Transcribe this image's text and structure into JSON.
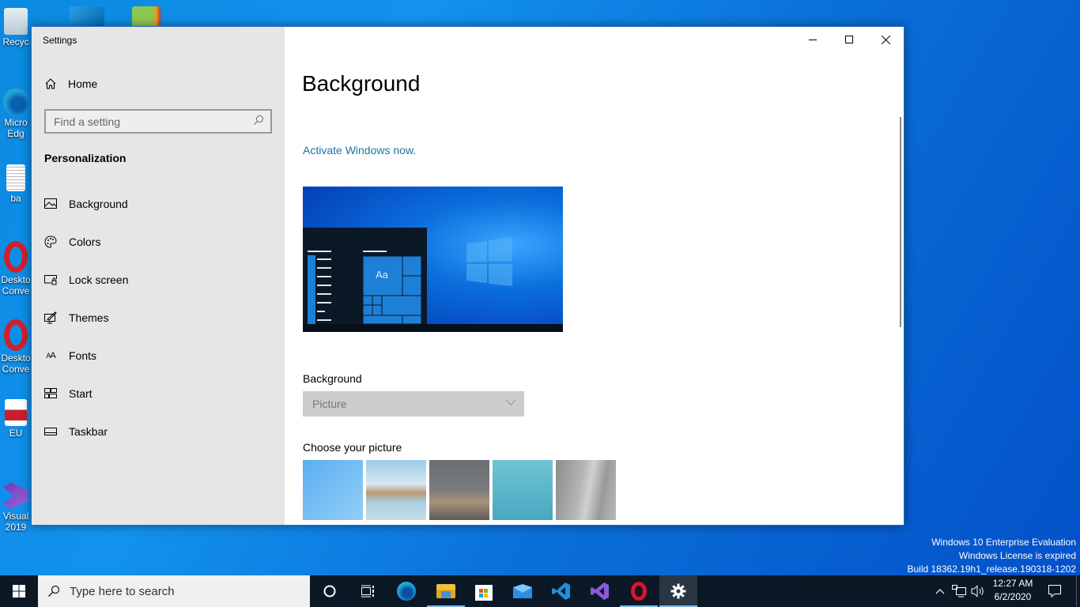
{
  "desktop": {
    "icons": [
      {
        "label": "Recyc",
        "name": "recycle-bin"
      },
      {
        "label": "Micro Edg",
        "name": "microsoft-edge"
      },
      {
        "label": "ba",
        "name": "text-file"
      },
      {
        "label": "Deskto Conve",
        "name": "desktop-converter-1"
      },
      {
        "label": "Deskto Conve",
        "name": "desktop-converter-2"
      },
      {
        "label": "EU",
        "name": "pdf-file"
      },
      {
        "label": "Visual 2019",
        "name": "visual-studio-2019"
      }
    ],
    "watermark": {
      "line1": "Windows 10 Enterprise Evaluation",
      "line2": "Windows License is expired",
      "line3": "Build 18362.19h1_release.190318-1202"
    }
  },
  "window": {
    "app_title": "Settings",
    "controls": {
      "minimize": "minimize",
      "maximize": "maximize",
      "close": "close"
    }
  },
  "sidebar": {
    "home_label": "Home",
    "search_placeholder": "Find a setting",
    "category": "Personalization",
    "items": [
      {
        "label": "Background",
        "icon": "picture-icon",
        "selected": true
      },
      {
        "label": "Colors",
        "icon": "palette-icon",
        "selected": false
      },
      {
        "label": "Lock screen",
        "icon": "lock-screen-icon",
        "selected": false
      },
      {
        "label": "Themes",
        "icon": "themes-icon",
        "selected": false
      },
      {
        "label": "Fonts",
        "icon": "fonts-icon",
        "selected": false
      },
      {
        "label": "Start",
        "icon": "start-icon",
        "selected": false
      },
      {
        "label": "Taskbar",
        "icon": "taskbar-icon",
        "selected": false
      }
    ]
  },
  "main": {
    "title": "Background",
    "activate_link": "Activate Windows now.",
    "preview_sample_text": "Aa",
    "background_label": "Background",
    "background_value": "Picture",
    "choose_label": "Choose your picture",
    "pictures": [
      {
        "name": "windows-light",
        "colors": [
          "#5fb3f0",
          "#8fcdf6"
        ]
      },
      {
        "name": "beach-rocks",
        "colors": [
          "#8fc2e6",
          "#c9a67a"
        ]
      },
      {
        "name": "night-sky-tent",
        "colors": [
          "#5d6268",
          "#9a8a70"
        ]
      },
      {
        "name": "underwater-swimmer",
        "colors": [
          "#4fb0c8",
          "#7ed0dc"
        ]
      },
      {
        "name": "rock-cliff",
        "colors": [
          "#9a9a9a",
          "#c8c8c8"
        ]
      }
    ]
  },
  "taskbar": {
    "search_placeholder": "Type here to search",
    "apps": [
      "cortana",
      "task-view",
      "edge",
      "file-explorer",
      "store",
      "mail",
      "vscode",
      "visual-studio",
      "opera",
      "settings"
    ],
    "clock_time": "12:27 AM",
    "clock_date": "6/2/2020"
  }
}
